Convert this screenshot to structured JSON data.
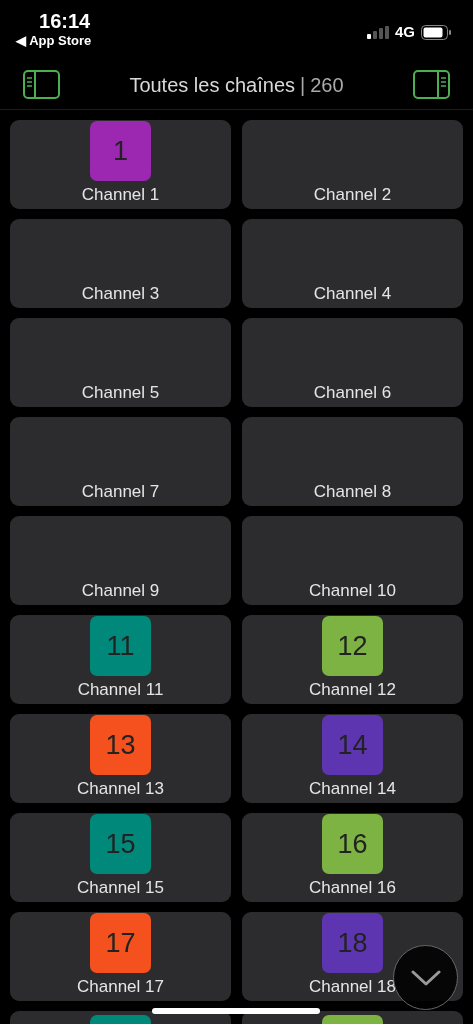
{
  "status_bar": {
    "time": "16:14",
    "back_link": "◀ App Store",
    "network": "4G"
  },
  "header": {
    "title": "Toutes les chaînes",
    "separator": "|",
    "count": "260"
  },
  "channels": [
    {
      "label": "Channel 1",
      "badge": "1",
      "color": "#9c27b0"
    },
    {
      "label": "Channel 2"
    },
    {
      "label": "Channel 3"
    },
    {
      "label": "Channel 4"
    },
    {
      "label": "Channel 5"
    },
    {
      "label": "Channel 6"
    },
    {
      "label": "Channel 7"
    },
    {
      "label": "Channel 8"
    },
    {
      "label": "Channel 9"
    },
    {
      "label": "Channel 10"
    },
    {
      "label": "Channel 11",
      "badge": "11",
      "color": "#00897b"
    },
    {
      "label": "Channel 12",
      "badge": "12",
      "color": "#7cb342"
    },
    {
      "label": "Channel 13",
      "badge": "13",
      "color": "#f4511e"
    },
    {
      "label": "Channel 14",
      "badge": "14",
      "color": "#5e35b1"
    },
    {
      "label": "Channel 15",
      "badge": "15",
      "color": "#00897b"
    },
    {
      "label": "Channel 16",
      "badge": "16",
      "color": "#7cb342"
    },
    {
      "label": "Channel 17",
      "badge": "17",
      "color": "#f4511e"
    },
    {
      "label": "Channel 18",
      "badge": "18",
      "color": "#5e35b1"
    },
    {
      "color": "#00897b"
    },
    {
      "color": "#7cb342"
    }
  ]
}
